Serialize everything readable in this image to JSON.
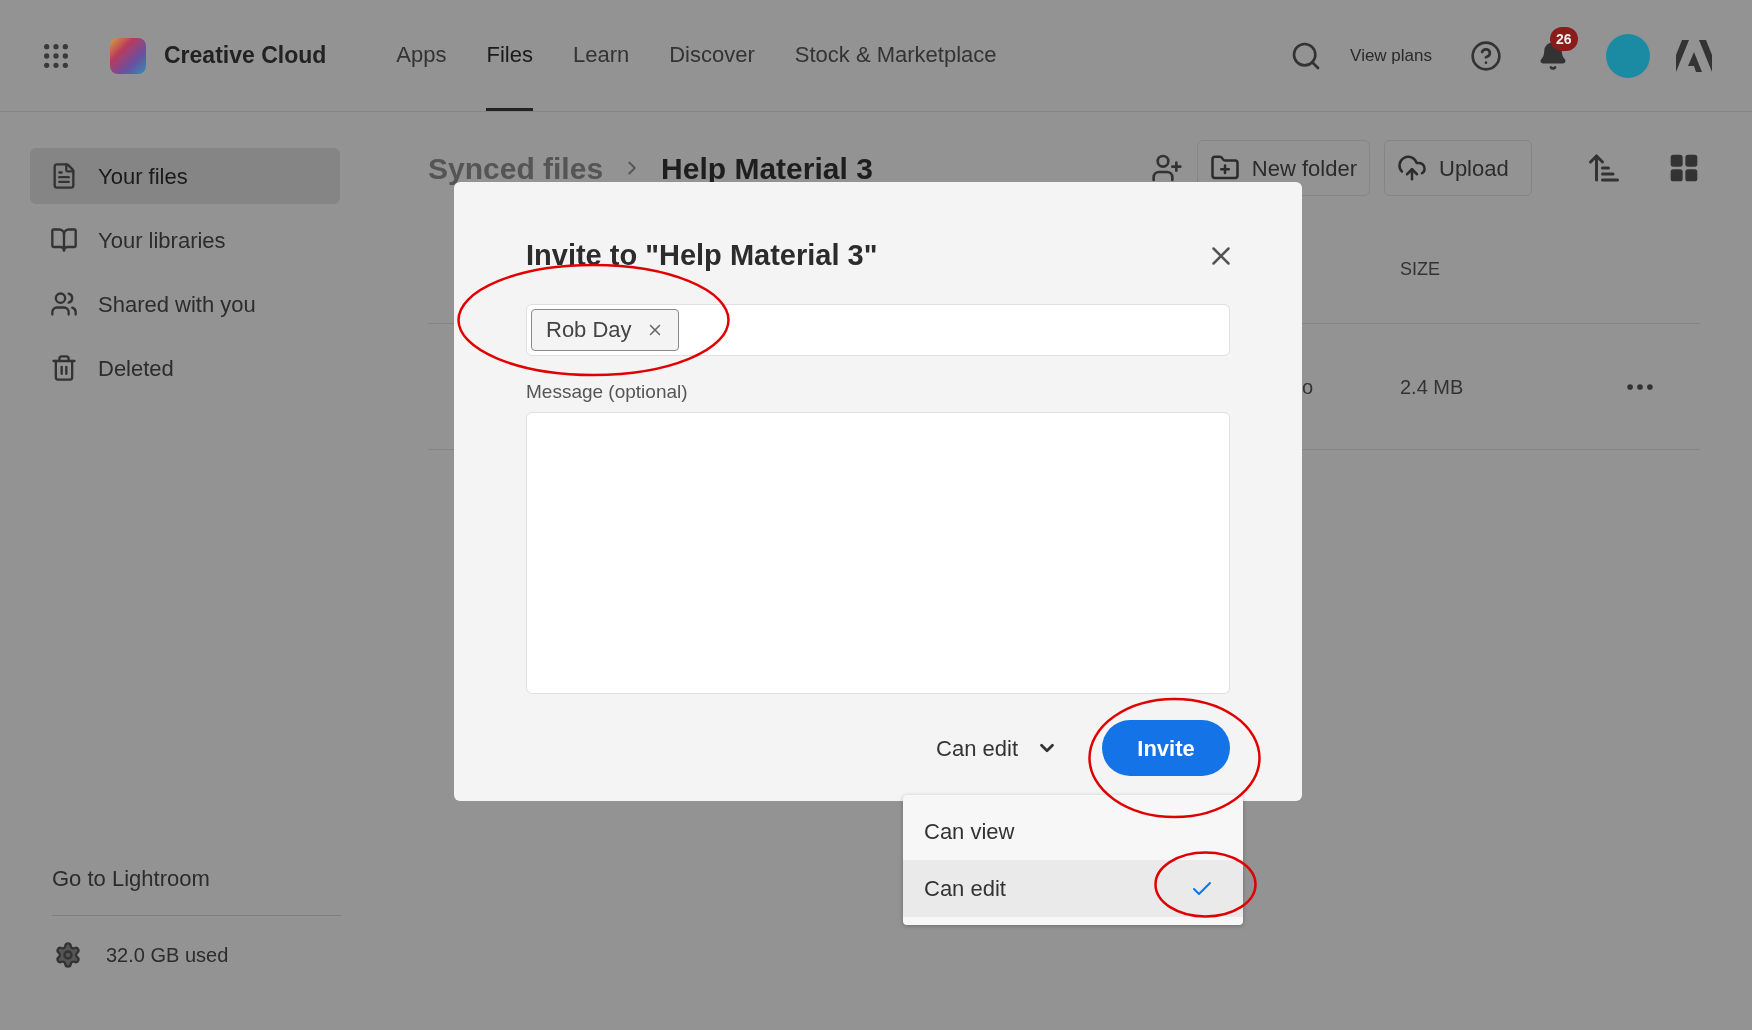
{
  "header": {
    "app_name": "Creative Cloud",
    "nav": [
      {
        "label": "Apps",
        "selected": false
      },
      {
        "label": "Files",
        "selected": true
      },
      {
        "label": "Learn",
        "selected": false
      },
      {
        "label": "Discover",
        "selected": false
      },
      {
        "label": "Stock & Marketplace",
        "selected": false
      }
    ],
    "view_plans": "View plans",
    "notification_count": "26"
  },
  "sidebar": {
    "items": [
      {
        "label": "Your files",
        "selected": true
      },
      {
        "label": "Your libraries",
        "selected": false
      },
      {
        "label": "Shared with you",
        "selected": false
      },
      {
        "label": "Deleted",
        "selected": false
      }
    ],
    "go_to": "Go to Lightroom",
    "storage": "32.0 GB used"
  },
  "breadcrumb": [
    {
      "label": "Synced files",
      "current": false
    },
    {
      "label": "Help Material 3",
      "current": true
    }
  ],
  "toolbar": {
    "new_folder": "New folder",
    "upload": "Upload"
  },
  "table": {
    "columns": [
      "SIZE"
    ],
    "rows": [
      {
        "column_1": "o",
        "size": "2.4 MB"
      }
    ]
  },
  "dialog": {
    "title": "Invite to \"Help Material 3\"",
    "recipients": [
      "Rob Day"
    ],
    "message_label": "Message (optional)",
    "permission": "Can edit",
    "invite": "Invite"
  },
  "permission_menu": [
    {
      "label": "Can view",
      "selected": false
    },
    {
      "label": "Can edit",
      "selected": true
    }
  ]
}
